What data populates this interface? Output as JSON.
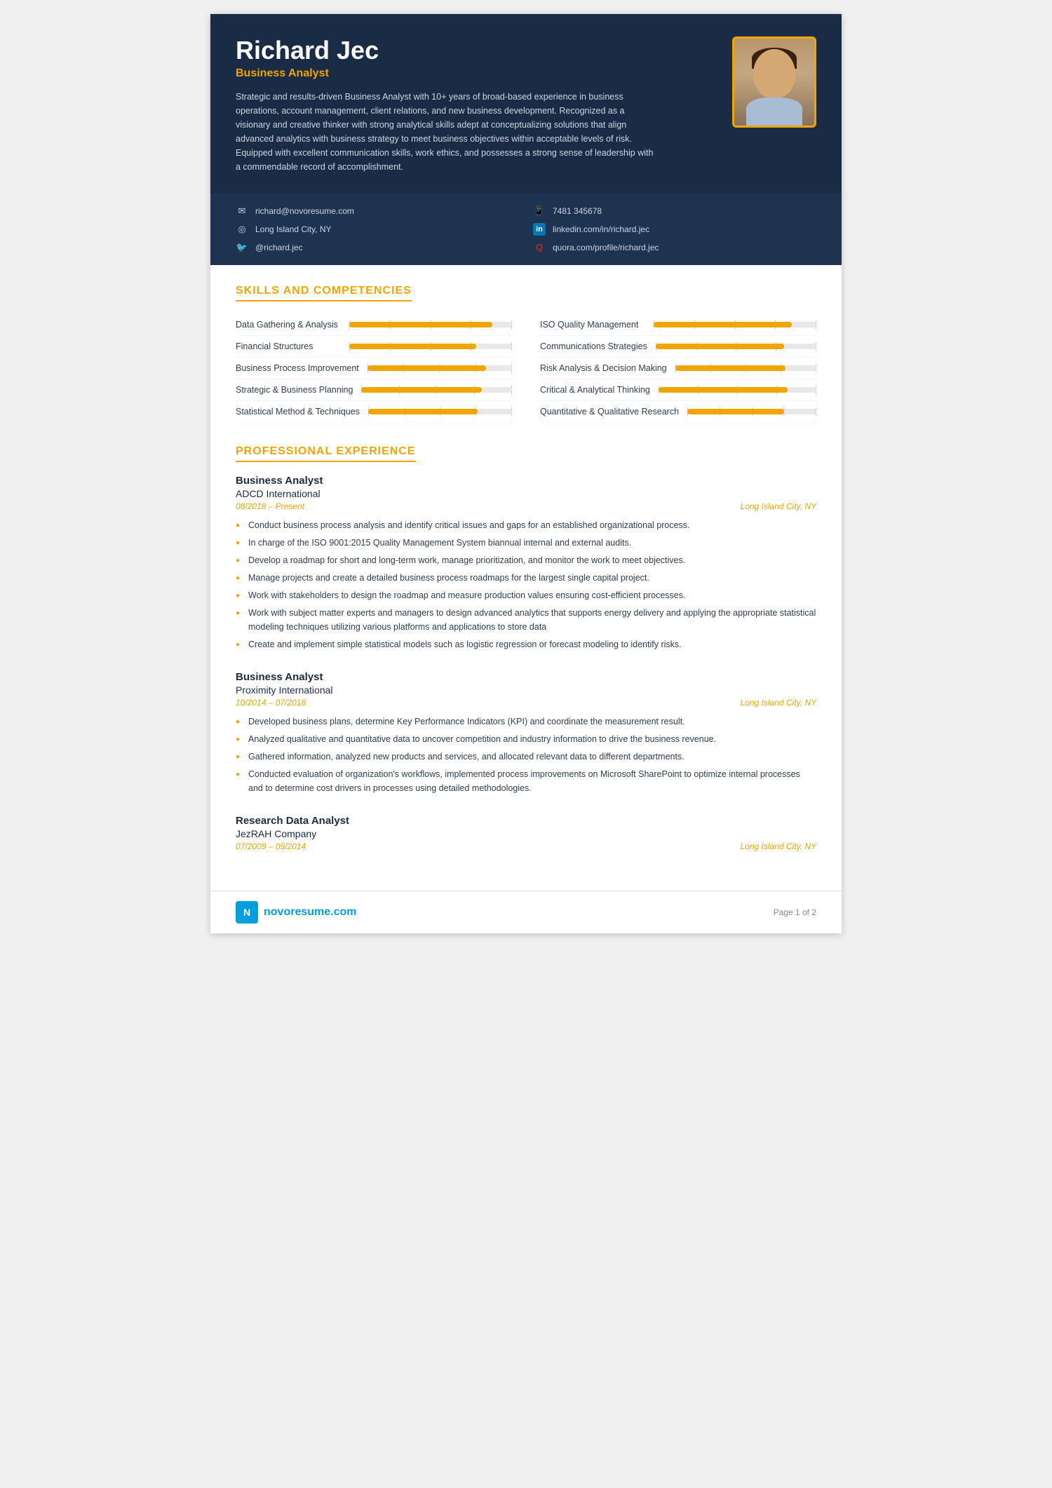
{
  "header": {
    "name": "Richard Jec",
    "title": "Business Analyst",
    "summary": "Strategic and results-driven Business Analyst with 10+ years of broad-based experience in business operations, account management, client relations, and new business development. Recognized as a visionary and creative thinker with strong analytical skills adept at conceptualizing solutions that align advanced analytics with business strategy to meet business objectives within acceptable levels of risk. Equipped with excellent communication skills, work ethics, and possesses a strong sense of leadership with a commendable record of accomplishment."
  },
  "contact": [
    {
      "icon": "✉",
      "label": "richard@novoresume.com",
      "id": "email"
    },
    {
      "icon": "◎",
      "label": "Long Island City, NY",
      "id": "location"
    },
    {
      "icon": "🐦",
      "label": "@richard.jec",
      "id": "twitter"
    },
    {
      "icon": "📱",
      "label": "7481 345678",
      "id": "phone"
    },
    {
      "icon": "in",
      "label": "linkedin.com/in/richard.jec",
      "id": "linkedin"
    },
    {
      "icon": "Q",
      "label": "quora.com/profile/richard.jec",
      "id": "quora"
    }
  ],
  "skills_section_title": "SKILLS AND COMPETENCIES",
  "skills_left": [
    {
      "name": "Data Gathering & Analysis",
      "percent": 88
    },
    {
      "name": "Financial Structures",
      "percent": 78
    },
    {
      "name": "Business Process Improvement",
      "percent": 82
    },
    {
      "name": "Strategic & Business Planning",
      "percent": 80
    },
    {
      "name": "Statistical Method & Techniques",
      "percent": 76
    }
  ],
  "skills_right": [
    {
      "name": "ISO Quality Management",
      "percent": 85
    },
    {
      "name": "Communications Strategies",
      "percent": 80
    },
    {
      "name": "Risk Analysis & Decision Making",
      "percent": 78
    },
    {
      "name": "Critical & Analytical Thinking",
      "percent": 82
    },
    {
      "name": "Quantitative & Qualitative Research",
      "percent": 75
    }
  ],
  "experience_section_title": "PROFESSIONAL EXPERIENCE",
  "jobs": [
    {
      "title": "Business Analyst",
      "company": "ADCD International",
      "dates": "08/2018 – Present",
      "location": "Long Island City, NY",
      "bullets": [
        "Conduct business process analysis and identify critical issues and gaps for an established organizational process.",
        "In charge of the ISO 9001:2015 Quality Management System biannual internal and external audits.",
        "Develop a roadmap for short and long-term work, manage prioritization, and monitor the work to meet objectives.",
        "Manage projects and create a detailed business process roadmaps for the largest single capital project.",
        "Work with stakeholders to design the roadmap and measure production values ensuring cost-efficient processes.",
        "Work with subject matter experts and managers to design advanced analytics that supports energy delivery and applying the appropriate statistical modeling techniques utilizing various platforms and applications to store data",
        "Create and implement simple statistical models such as logistic regression or forecast modeling to identify risks."
      ]
    },
    {
      "title": "Business Analyst",
      "company": "Proximity International",
      "dates": "10/2014 – 07/2018",
      "location": "Long Island City, NY",
      "bullets": [
        "Developed business plans, determine Key Performance Indicators (KPI) and coordinate the measurement result.",
        "Analyzed qualitative and quantitative data to uncover competition and industry information to drive the business revenue.",
        "Gathered information, analyzed new products and services, and allocated relevant data to different departments.",
        "Conducted evaluation of organization's workflows, implemented process improvements on Microsoft SharePoint to optimize internal processes and to determine cost drivers in processes using detailed methodologies."
      ]
    },
    {
      "title": "Research Data Analyst",
      "company": "JezRAH Company",
      "dates": "07/2009 – 09/2014",
      "location": "Long Island City, NY",
      "bullets": []
    }
  ],
  "footer": {
    "logo_text": "novoresume.com",
    "page_label": "Page 1 of 2"
  }
}
